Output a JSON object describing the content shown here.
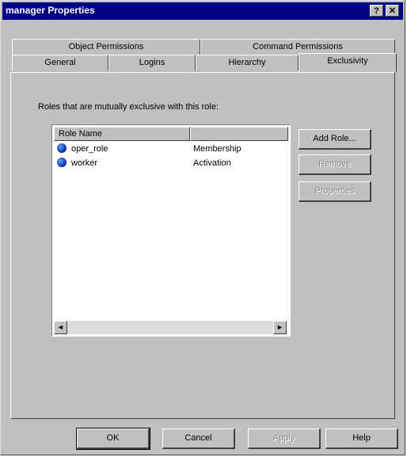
{
  "window": {
    "title": "manager Properties"
  },
  "titlebar_buttons": {
    "help": "?",
    "close": "✕"
  },
  "tabs_row1": [
    "Object Permissions",
    "Command Permissions"
  ],
  "tabs_row2": [
    "General",
    "Logins",
    "Hierarchy",
    "Exclusivity"
  ],
  "active_tab": "Exclusivity",
  "description": "Roles that are mutually exclusive with this role:",
  "list": {
    "columns": [
      "Role Name",
      ""
    ],
    "rows": [
      {
        "name": "oper_role",
        "type": "Membership"
      },
      {
        "name": "worker",
        "type": "Activation"
      }
    ]
  },
  "side_buttons": {
    "add": "Add Role...",
    "remove": "Remove",
    "properties": "Properties"
  },
  "footer_buttons": {
    "ok": "OK",
    "cancel": "Cancel",
    "apply": "Apply",
    "help": "Help"
  },
  "icons": {
    "role": "role-icon",
    "scroll_left": "◄",
    "scroll_right": "►"
  }
}
